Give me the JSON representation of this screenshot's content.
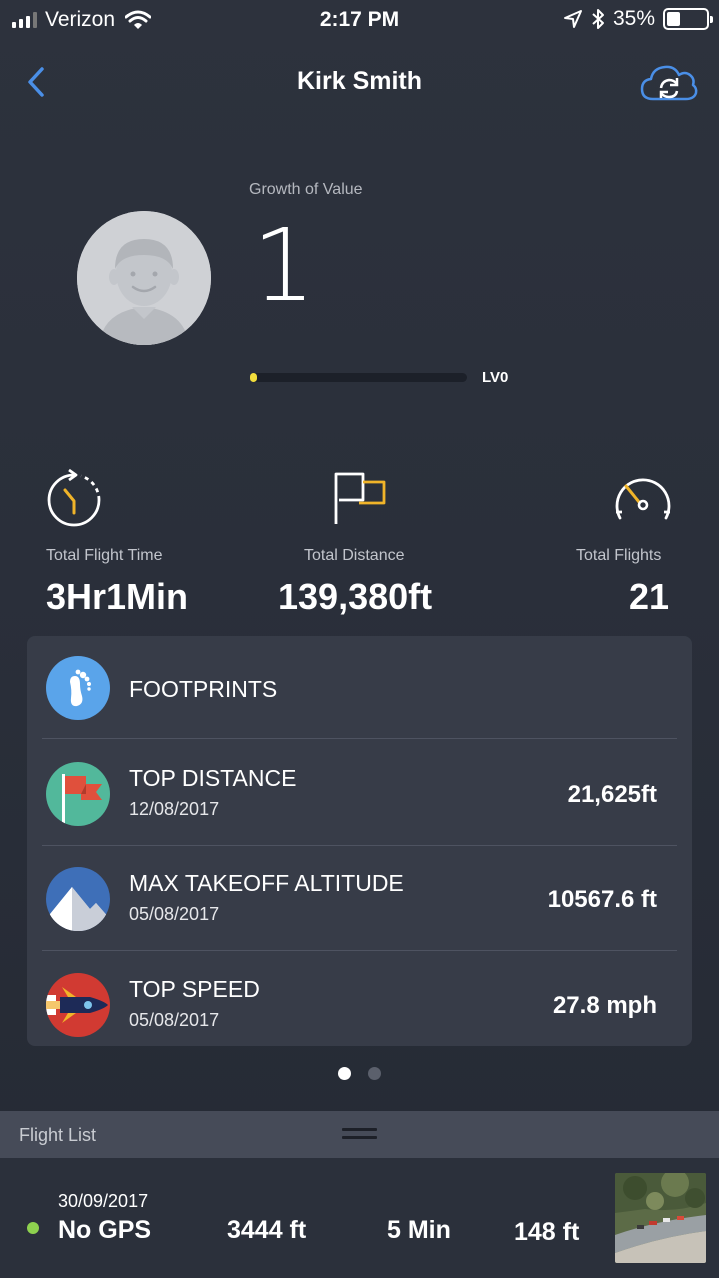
{
  "status_bar": {
    "carrier": "Verizon",
    "time": "2:17 PM",
    "battery": "35%",
    "battery_level": 0.35
  },
  "nav": {
    "title": "Kirk Smith",
    "back_icon": "chevron-left-icon",
    "sync_icon": "cloud-sync-icon"
  },
  "profile": {
    "growth_label": "Growth of Value",
    "growth_value": "1",
    "level_label": "LV0",
    "level_progress": 0.02
  },
  "stats": [
    {
      "icon": "stopwatch-icon",
      "label": "Total Flight Time",
      "value": "3Hr1Min"
    },
    {
      "icon": "flag-icon",
      "label": "Total Distance",
      "value": "139,380ft"
    },
    {
      "icon": "speedometer-icon",
      "label": "Total Flights",
      "value": "21"
    }
  ],
  "records": {
    "footprints_label": "FOOTPRINTS",
    "items": [
      {
        "icon": "flag-record-icon",
        "title": "TOP DISTANCE",
        "date": "12/08/2017",
        "value": "21,625ft"
      },
      {
        "icon": "mountain-icon",
        "title": "MAX TAKEOFF ALTITUDE",
        "date": "05/08/2017",
        "value": "10567.6 ft"
      },
      {
        "icon": "rocket-icon",
        "title": "TOP SPEED",
        "date": "05/08/2017",
        "value": "27.8 mph"
      }
    ]
  },
  "pager": {
    "pages": 2,
    "active": 0
  },
  "flight_list": {
    "header": "Flight List",
    "rows": [
      {
        "date": "30/09/2017",
        "status": "No GPS",
        "distance": "3444 ft",
        "duration": "5 Min",
        "altitude": "148 ft"
      }
    ]
  },
  "colors": {
    "accent_blue": "#4a8fe7",
    "gold": "#f0b429",
    "level_yellow": "#f2dd3c",
    "online_green": "#8ed14f",
    "card_bg": "#373c48"
  }
}
